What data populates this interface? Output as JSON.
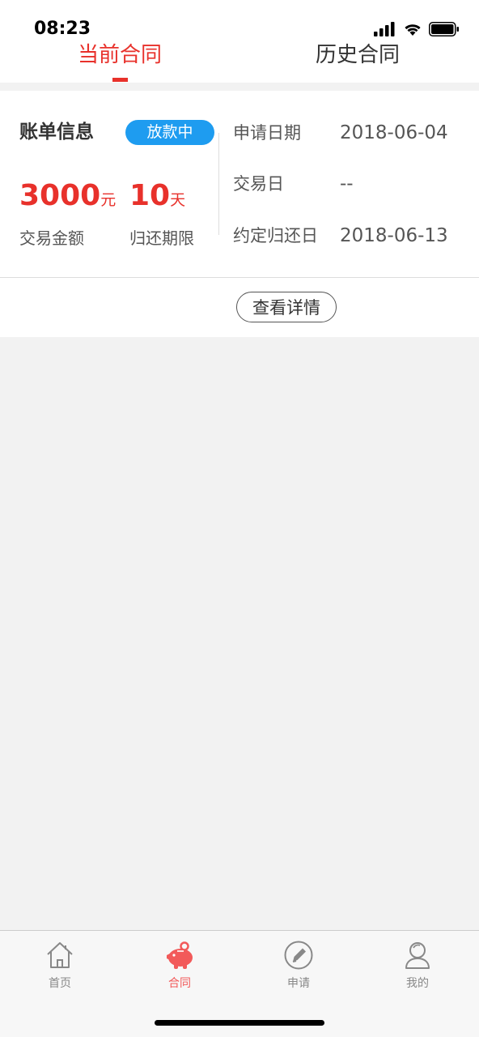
{
  "status_bar": {
    "time": "08:23",
    "icons": [
      "signal-icon",
      "wifi-icon",
      "battery-icon"
    ]
  },
  "tabs": {
    "current": "当前合同",
    "history": "历史合同",
    "active": "current",
    "accent_color": "#e8312b"
  },
  "bill": {
    "title": "账单信息",
    "status_badge": "放款中",
    "badge_color": "#1e9cf0",
    "amount": "3000",
    "amount_unit": "元",
    "amount_label": "交易金额",
    "term": "10",
    "term_unit": "天",
    "term_label": "归还期限",
    "apply_date_label": "申请日期",
    "apply_date": "2018-06-04",
    "trade_date_label": "交易日",
    "trade_date": "--",
    "due_date_label": "约定归还日",
    "due_date": "2018-06-13",
    "detail_button": "查看详情"
  },
  "tabbar": {
    "items": [
      {
        "label": "首页",
        "icon": "home-icon",
        "active": false
      },
      {
        "label": "合同",
        "icon": "piggy-bank-icon",
        "active": true
      },
      {
        "label": "申请",
        "icon": "pencil-icon",
        "active": false
      },
      {
        "label": "我的",
        "icon": "user-icon",
        "active": false
      }
    ],
    "active_color": "#f25a5a",
    "inactive_color": "#888888"
  }
}
